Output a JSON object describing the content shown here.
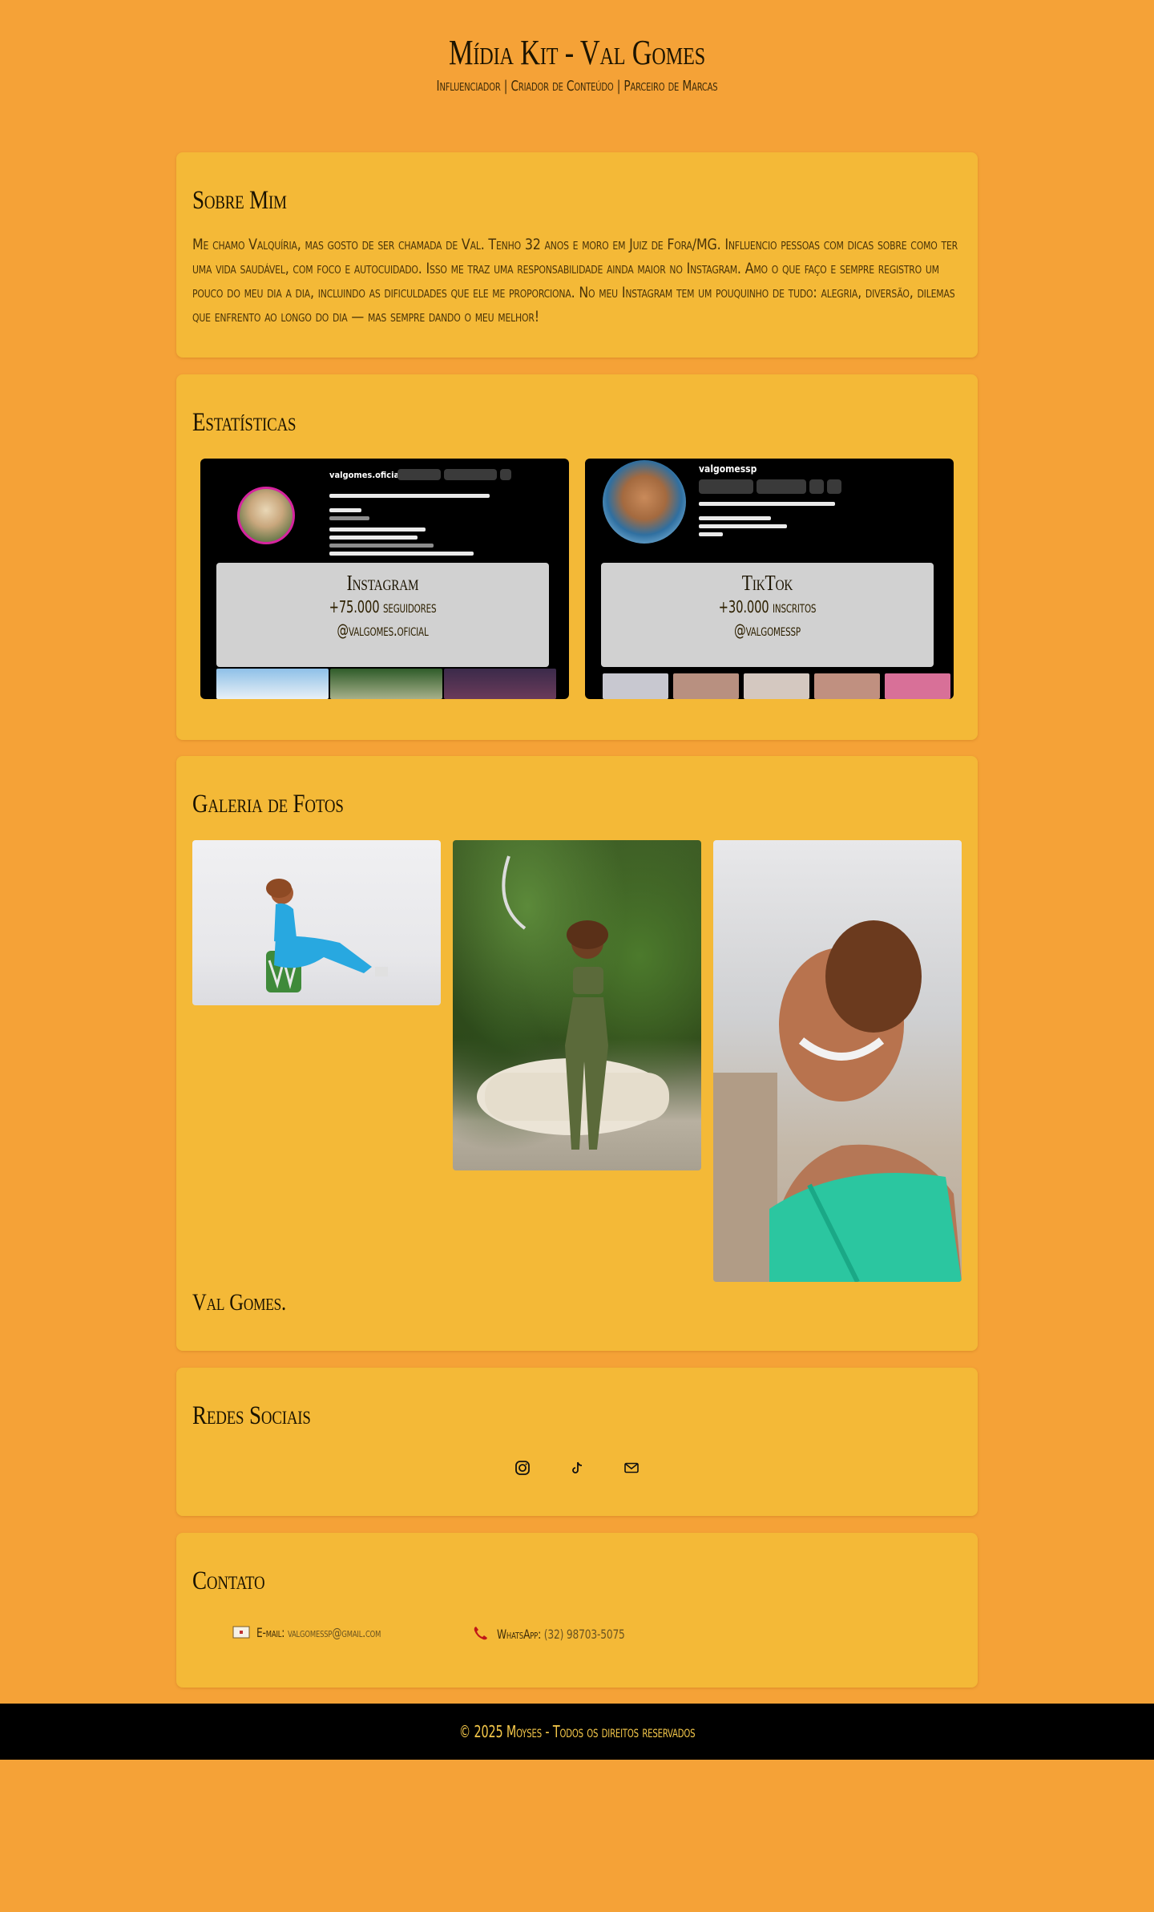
{
  "header": {
    "title": "Mídia Kit - Val Gomes",
    "subtitle": "Influenciador | Criador de Conteúdo | Parceiro de Marcas"
  },
  "about": {
    "heading": "Sobre Mim",
    "text": "Me chamo Valquíria, mas gosto de ser chamada de Val. Tenho 32 anos e moro em Juiz de Fora/MG. Influencio pessoas com dicas sobre como ter uma vida saudável, com foco e autocuidado. Isso me traz uma responsabilidade ainda maior no Instagram. Amo o que faço e sempre registro um pouco do meu dia a dia, incluindo as dificuldades que ele me proporciona. No meu Instagram tem um pouquinho de tudo: alegria, diversão, dilemas que enfrento ao longo do dia — mas sempre dando o meu melhor!"
  },
  "stats": {
    "heading": "Estatísticas",
    "instagram": {
      "title": "Instagram",
      "followers": "+75.000 seguidores",
      "handle": "@valgomes.oficial",
      "screenshot_username": "valgomes.oficial"
    },
    "tiktok": {
      "title": "TikTok",
      "followers": "+30.000 inscritos",
      "handle": "@valgomessp",
      "screenshot_username": "valgomessp"
    }
  },
  "gallery": {
    "heading": "Galeria de Fotos",
    "caption": "Val Gomes."
  },
  "social": {
    "heading": "Redes Sociais",
    "icons": [
      "instagram-icon",
      "tiktok-icon",
      "email-icon"
    ]
  },
  "contact": {
    "heading": "Contato",
    "email_label": "E-mail:",
    "email_value": "valgomessp@gmail.com",
    "whatsapp_label": "WhatsApp:",
    "whatsapp_value": "(32) 98703-5075"
  },
  "footer": {
    "text": "© 2025 Moyses - Todos os direitos reservados"
  },
  "colors": {
    "page_bg": "#f5a237",
    "card_bg": "#f4b937",
    "footer_bg": "#000000",
    "footer_text": "#f5c84a"
  }
}
